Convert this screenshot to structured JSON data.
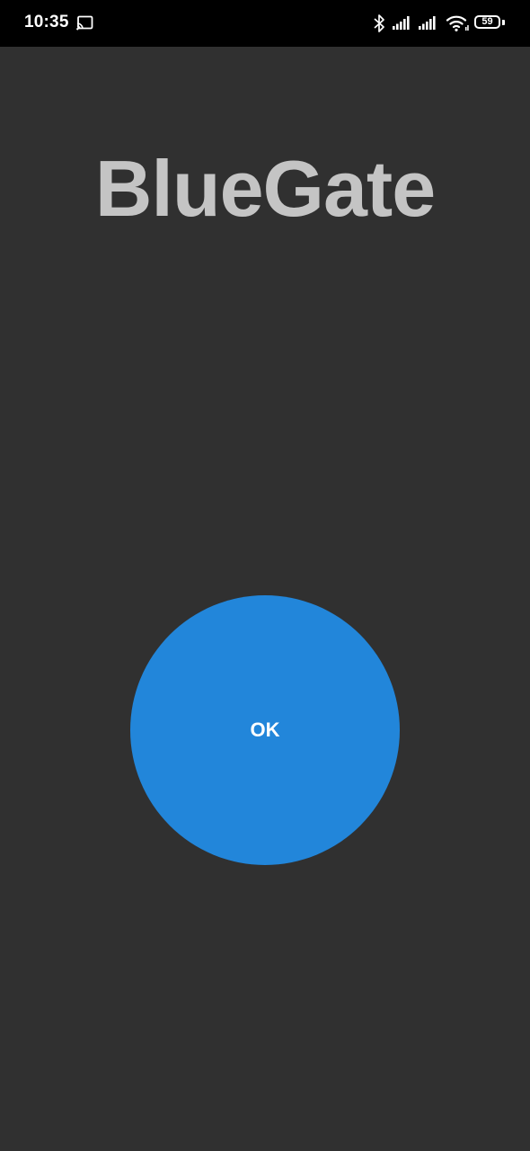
{
  "status_bar": {
    "time": "10:35",
    "battery_level": "59",
    "icons": [
      "cast-icon",
      "bluetooth-icon",
      "cellular-signal-icon",
      "cellular-signal-icon",
      "wifi-icon",
      "battery-icon"
    ]
  },
  "app": {
    "title": "BlueGate",
    "ok_button_label": "OK"
  },
  "colors": {
    "background": "#303030",
    "status_bar": "#000000",
    "title_text": "#c4c4c4",
    "button": "#2286da",
    "button_text": "#ffffff"
  }
}
